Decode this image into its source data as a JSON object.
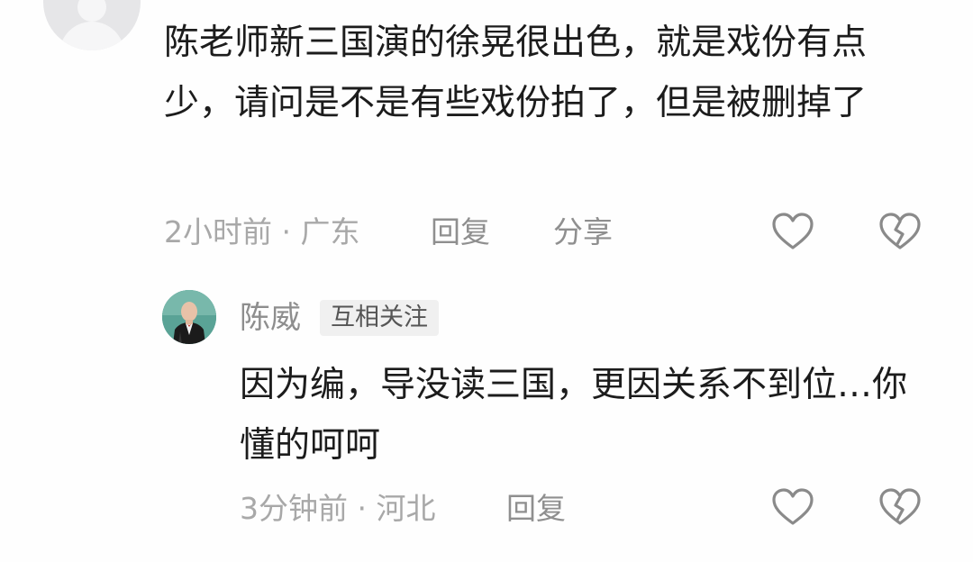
{
  "comment": {
    "text": "陈老师新三国演的徐晃很出色，就是戏份有点少，请问是不是有些戏份拍了，但是被删掉了",
    "meta": "2小时前 · 广东",
    "reply_label": "回复",
    "share_label": "分享"
  },
  "reply": {
    "author": "陈威",
    "badge": "互相关注",
    "text": "因为编，导没读三国，更因关系不到位…你懂的呵呵",
    "meta": "3分钟前 · 河北",
    "reply_label": "回复"
  },
  "icons": {
    "like": "heart-outline-icon",
    "dislike": "broken-heart-icon",
    "avatar_placeholder": "default-user-icon"
  },
  "colors": {
    "text": "#1c1c1c",
    "meta": "#a3a3a3",
    "icon": "#8a8a8a",
    "badge_bg": "#f0f0f0"
  }
}
